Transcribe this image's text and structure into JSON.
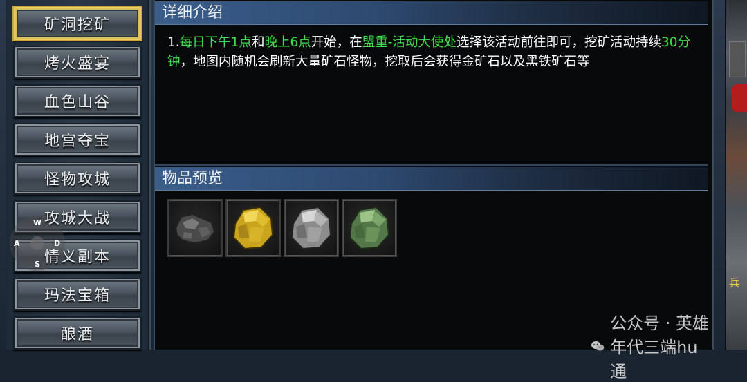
{
  "menu": {
    "items": [
      {
        "label": "矿洞挖矿",
        "active": true
      },
      {
        "label": "烤火盛宴",
        "active": false
      },
      {
        "label": "血色山谷",
        "active": false
      },
      {
        "label": "地宫夺宝",
        "active": false
      },
      {
        "label": "怪物攻城",
        "active": false
      },
      {
        "label": "攻城大战",
        "active": false
      },
      {
        "label": "情义副本",
        "active": false
      },
      {
        "label": "玛法宝箱",
        "active": false
      },
      {
        "label": "酿酒",
        "active": false
      }
    ]
  },
  "detail": {
    "title": "详细介绍",
    "desc": {
      "p1": "1.",
      "g1": "每日下午1点",
      "p2": "和",
      "g2": "晚上6点",
      "p3": "开始，在",
      "g3": "盟重-活动大使处",
      "p4": "选择该活动前往即可，挖矿活动持续",
      "g4": "30分钟",
      "p5": "，地图内随机会刷新大量矿石怪物，挖取后会获得金矿石以及黑铁矿石等"
    }
  },
  "preview": {
    "title": "物品预览",
    "items": [
      {
        "icon": "black-ore-icon",
        "color": "#6e6e6e"
      },
      {
        "icon": "gold-ore-icon",
        "color": "#d7b521"
      },
      {
        "icon": "silver-ore-icon",
        "color": "#a9a9a9"
      },
      {
        "icon": "jade-ore-icon",
        "color": "#6f9a5a"
      }
    ]
  },
  "joystick": {
    "up": "W",
    "left": "A",
    "right": "D",
    "down": "S"
  },
  "scene": {
    "badge": "兵"
  },
  "watermark": {
    "text": "公众号 · 英雄年代三端hu通"
  },
  "colors": {
    "highlight_green": "#3de04a",
    "active_border": "#e8cf62"
  }
}
